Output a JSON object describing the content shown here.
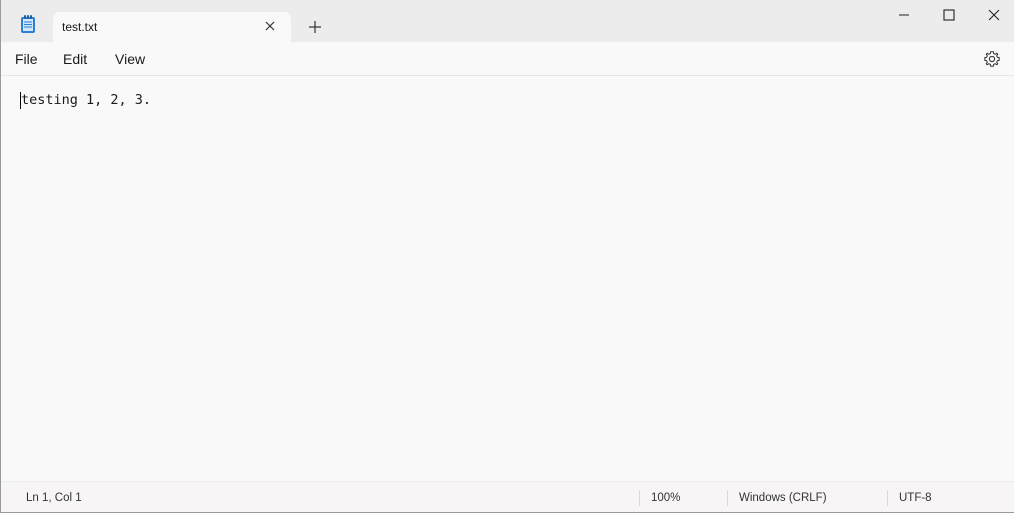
{
  "app": {
    "icon": "notepad-icon"
  },
  "tab": {
    "title": "test.txt",
    "close_icon": "close-icon"
  },
  "titlebar": {
    "new_tab_icon": "plus-icon",
    "minimize_icon": "minimize-icon",
    "maximize_icon": "maximize-icon",
    "close_icon": "close-icon"
  },
  "menu": {
    "file": "File",
    "edit": "Edit",
    "view": "View",
    "settings_icon": "gear-icon"
  },
  "editor": {
    "content": "testing 1, 2, 3."
  },
  "status": {
    "position": "Ln 1, Col 1",
    "zoom": "100%",
    "line_ending": "Windows (CRLF)",
    "encoding": "UTF-8"
  },
  "colors": {
    "titlebar_bg": "#ececec",
    "editor_bg": "#f9f9f9",
    "icon_accent": "#3a8fd6"
  }
}
